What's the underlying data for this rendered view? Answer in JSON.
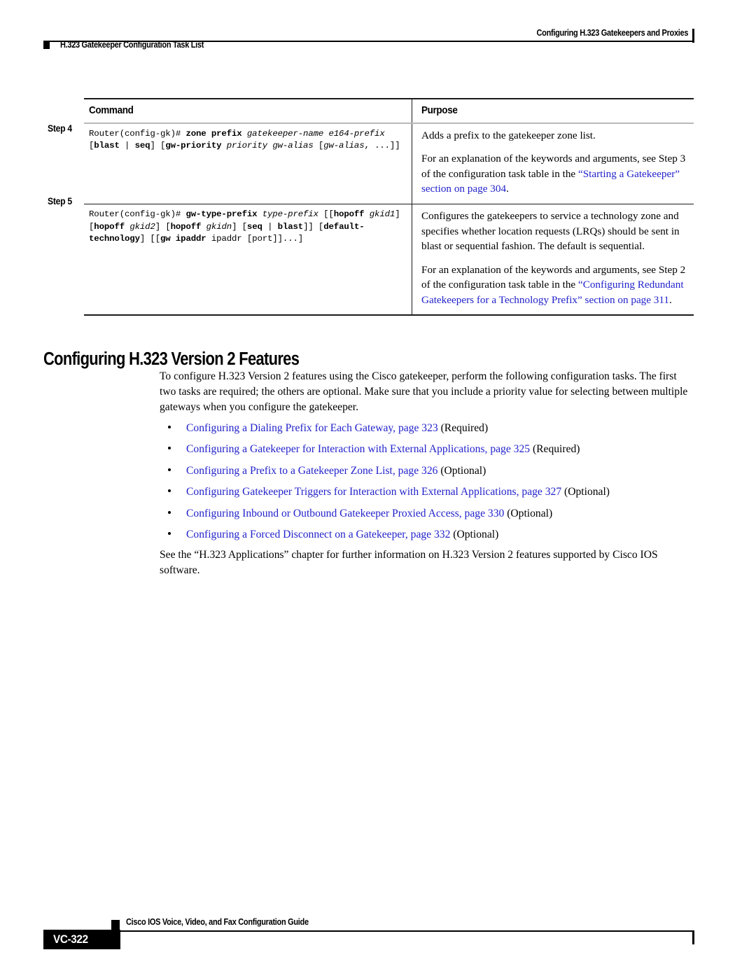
{
  "page": {
    "running_header": "Configuring H.323 Gatekeepers and Proxies",
    "section_marker": "H.323 Gatekeeper Configuration Task List",
    "page_number": "VC-322",
    "footer_guide": "Cisco IOS Voice, Video, and Fax Configuration Guide",
    "link_color": "#2222cc"
  },
  "table": {
    "headers": {
      "command": "Command",
      "purpose": "Purpose"
    },
    "rows": [
      {
        "step_label": "Step 4",
        "command_segments": [
          {
            "text": "Router(config-gk)# ",
            "style": "plain"
          },
          {
            "text": "zone prefix",
            "style": "bold"
          },
          {
            "text": " ",
            "style": "plain"
          },
          {
            "text": "gatekeeper-name e164-prefix",
            "style": "italic"
          },
          {
            "text": " [",
            "style": "plain"
          },
          {
            "text": "blast",
            "style": "bold"
          },
          {
            "text": " | ",
            "style": "plain"
          },
          {
            "text": "seq",
            "style": "bold"
          },
          {
            "text": "] [",
            "style": "plain"
          },
          {
            "text": "gw-priority",
            "style": "bold"
          },
          {
            "text": " ",
            "style": "plain"
          },
          {
            "text": "priority gw-alias",
            "style": "italic"
          },
          {
            "text": " [",
            "style": "plain"
          },
          {
            "text": "gw-alias",
            "style": "italic"
          },
          {
            "text": ", ...]]",
            "style": "plain"
          }
        ],
        "purpose_paragraphs": [
          {
            "runs": [
              {
                "text": "Adds a prefix to the gatekeeper zone list.",
                "style": "plain"
              }
            ]
          },
          {
            "runs": [
              {
                "text": "For an explanation of the keywords and arguments, see Step 3 of the configuration task table in the ",
                "style": "plain"
              },
              {
                "text": "“Starting a Gatekeeper” section on page 304",
                "style": "xref"
              },
              {
                "text": ".",
                "style": "plain"
              }
            ]
          }
        ]
      },
      {
        "step_label": "Step 5",
        "command_segments": [
          {
            "text": "Router(config-gk)# ",
            "style": "plain"
          },
          {
            "text": "gw-type-prefix",
            "style": "bold"
          },
          {
            "text": " ",
            "style": "plain"
          },
          {
            "text": "type-prefix",
            "style": "italic"
          },
          {
            "text": " [[",
            "style": "plain"
          },
          {
            "text": "hopoff",
            "style": "bold"
          },
          {
            "text": " ",
            "style": "plain"
          },
          {
            "text": "gkid1",
            "style": "italic"
          },
          {
            "text": "] [",
            "style": "plain"
          },
          {
            "text": "hopoff",
            "style": "bold"
          },
          {
            "text": " ",
            "style": "plain"
          },
          {
            "text": "gkid2",
            "style": "italic"
          },
          {
            "text": "] [",
            "style": "plain"
          },
          {
            "text": "hopoff",
            "style": "bold"
          },
          {
            "text": " ",
            "style": "plain"
          },
          {
            "text": "gkidn",
            "style": "italic"
          },
          {
            "text": "] [",
            "style": "plain"
          },
          {
            "text": "seq",
            "style": "bold"
          },
          {
            "text": " | ",
            "style": "plain"
          },
          {
            "text": "blast",
            "style": "bold"
          },
          {
            "text": "]] [",
            "style": "plain"
          },
          {
            "text": "default-technology",
            "style": "bold"
          },
          {
            "text": "] [[",
            "style": "plain"
          },
          {
            "text": "gw ipaddr",
            "style": "bold"
          },
          {
            "text": " ipaddr [port]]...]",
            "style": "plain"
          }
        ],
        "purpose_paragraphs": [
          {
            "runs": [
              {
                "text": "Configures the gatekeepers to service a technology zone and specifies whether location requests (LRQs) should be sent in blast or sequential fashion. The default is sequential.",
                "style": "plain"
              }
            ]
          },
          {
            "runs": [
              {
                "text": "For an explanation of the keywords and arguments, see Step 2 of the configuration task table in the ",
                "style": "plain"
              },
              {
                "text": "“Configuring Redundant Gatekeepers for a Technology Prefix” section on page 311",
                "style": "xref"
              },
              {
                "text": ".",
                "style": "plain"
              }
            ]
          }
        ]
      }
    ]
  },
  "section": {
    "heading": "Configuring H.323 Version 2 Features",
    "intro": "To configure H.323 Version 2 features using the Cisco gatekeeper, perform the following configuration tasks. The first two tasks are required; the others are optional. Make sure that you include a priority value for selecting between multiple gateways when you configure the gatekeeper.",
    "bullets": [
      {
        "link": "Configuring a Dialing Prefix for Each Gateway, page 323",
        "suffix": " (Required)"
      },
      {
        "link": "Configuring a Gatekeeper for Interaction with External Applications, page 325",
        "suffix": " (Required)"
      },
      {
        "link": "Configuring a Prefix to a Gatekeeper Zone List, page 326",
        "suffix": " (Optional)"
      },
      {
        "link": "Configuring Gatekeeper Triggers for Interaction with External Applications, page 327",
        "suffix": " (Optional)"
      },
      {
        "link": "Configuring Inbound or Outbound Gatekeeper Proxied Access, page 330",
        "suffix": " (Optional)"
      },
      {
        "link": "Configuring a Forced Disconnect on a Gatekeeper, page 332",
        "suffix": " (Optional)"
      }
    ],
    "closing": "See the “H.323 Applications” chapter for further information on H.323 Version 2 features supported by Cisco IOS software."
  }
}
